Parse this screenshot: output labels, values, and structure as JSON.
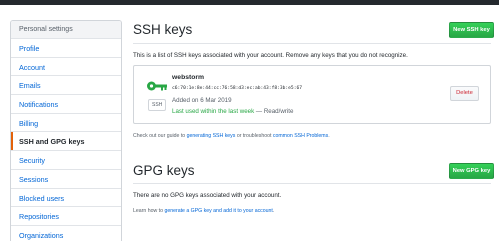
{
  "sidebar": {
    "header": "Personal settings",
    "items": [
      {
        "label": "Profile"
      },
      {
        "label": "Account"
      },
      {
        "label": "Emails"
      },
      {
        "label": "Notifications"
      },
      {
        "label": "Billing"
      },
      {
        "label": "SSH and GPG keys",
        "active": true
      },
      {
        "label": "Security"
      },
      {
        "label": "Sessions"
      },
      {
        "label": "Blocked users"
      },
      {
        "label": "Repositories"
      },
      {
        "label": "Organizations"
      }
    ]
  },
  "ssh": {
    "title": "SSH keys",
    "new_button": "New SSH key",
    "description": "This is a list of SSH keys associated with your account. Remove any keys that you do not recognize.",
    "key": {
      "icon": "key-icon",
      "tag": "SSH",
      "name": "webstorm",
      "fingerprint": "c6:70:1e:8e:44:cc:76:58:d3:ec:ab:43:f8:3b:e5:67",
      "added": "Added on 6 Mar 2019",
      "last_used": "Last used within the last week",
      "access": " — Read/write",
      "delete_label": "Delete"
    },
    "guide_prefix": "Check out our guide to ",
    "guide_link": "generating SSH keys",
    "guide_middle": " or troubleshoot ",
    "guide_link2": "common SSH Problems",
    "guide_suffix": "."
  },
  "gpg": {
    "title": "GPG keys",
    "new_button": "New GPG key",
    "empty": "There are no GPG keys associated with your account.",
    "learn_prefix": "Learn how to ",
    "learn_link": "generate a GPG key and add it to your account",
    "learn_suffix": "."
  },
  "colors": {
    "accent_green": "#28a745",
    "link_blue": "#0366d6",
    "danger_red": "#cb2431",
    "active_marker": "#e36209"
  }
}
